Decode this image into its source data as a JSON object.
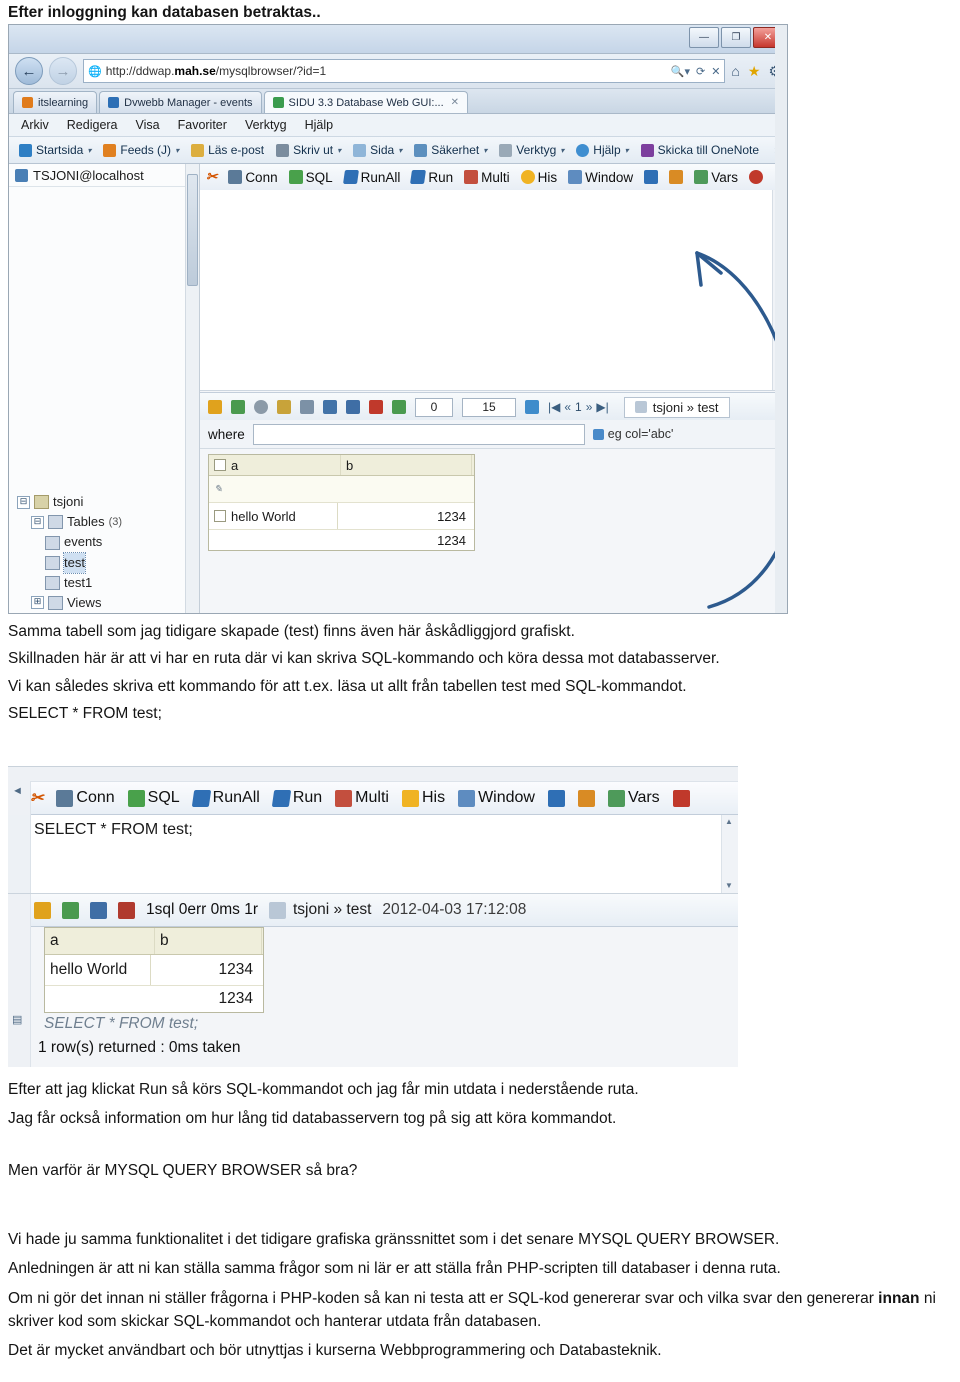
{
  "intro": "Efter inloggning kan databasen betraktas..",
  "screenshot1": {
    "browser": {
      "window_buttons": [
        "—",
        "❐",
        "✕"
      ],
      "url_prefix": "http://ddwap.",
      "url_bold": "mah.se",
      "url_suffix": "/mysqlbrowser/?id=1",
      "url_right_icons": [
        "search-caret",
        "refresh",
        "stop"
      ],
      "address_icons": [
        "home",
        "favorites-star",
        "tools-gear"
      ],
      "tabs": [
        {
          "label": "itslearning",
          "icon": "orange-square"
        },
        {
          "label": "Dvwebb Manager - events",
          "icon": "blue-square"
        },
        {
          "label": "SIDU 3.3 Database Web GUI:...",
          "icon": "green-square",
          "close": "✕",
          "active": true
        }
      ],
      "menu": [
        "Arkiv",
        "Redigera",
        "Visa",
        "Favoriter",
        "Verktyg",
        "Hjälp"
      ],
      "command_bar": [
        {
          "label": "Startsida",
          "icon": "home-icon",
          "caret": "▾"
        },
        {
          "label": "Feeds (J)",
          "icon": "feed-icon",
          "caret": "▾"
        },
        {
          "label": "Läs e-post",
          "icon": "mail-icon"
        },
        {
          "label": "Skriv ut",
          "icon": "print-icon",
          "caret": "▾"
        },
        {
          "label": "Sida",
          "icon": "page-icon",
          "caret": "▾"
        },
        {
          "label": "Säkerhet",
          "icon": "security-icon",
          "caret": "▾"
        },
        {
          "label": "Verktyg",
          "icon": "tools-icon",
          "caret": "▾"
        },
        {
          "label": "Hjälp",
          "icon": "help-icon",
          "caret": "▾"
        },
        {
          "label": "Skicka till OneNote",
          "icon": "onenote-icon"
        }
      ],
      "overflow": "»"
    },
    "left_panel": {
      "header": "TSJONI@localhost",
      "tree": [
        {
          "label": "tsjoni",
          "expander": "⊟",
          "level": 0,
          "icon": "db-icon"
        },
        {
          "label": "Tables",
          "count": "(3)",
          "expander": "⊟",
          "level": 1,
          "icon": "folder-icon"
        },
        {
          "label": "events",
          "level": 2,
          "icon": "table-icon"
        },
        {
          "label": "test",
          "level": 2,
          "icon": "table-icon",
          "selected": true
        },
        {
          "label": "test1",
          "level": 2,
          "icon": "table-icon"
        },
        {
          "label": "Views",
          "expander": "⊞",
          "level": 1,
          "icon": "folder-icon"
        }
      ]
    },
    "sidu_toolbar": [
      {
        "label": "",
        "icon": "scissors-icon"
      },
      {
        "label": "Conn",
        "icon": "conn-icon"
      },
      {
        "label": "SQL",
        "icon": "sql-icon"
      },
      {
        "label": "RunAll",
        "icon": "runall-icon"
      },
      {
        "label": "Run",
        "icon": "run-icon"
      },
      {
        "label": "Multi",
        "icon": "multi-icon"
      },
      {
        "label": "His",
        "icon": "history-icon"
      },
      {
        "label": "Window",
        "icon": "window-icon"
      },
      {
        "label": "",
        "icon": "arrow-left-icon"
      },
      {
        "label": "",
        "icon": "pin-icon"
      },
      {
        "label": "Vars",
        "icon": "vars-icon"
      },
      {
        "label": "",
        "icon": "stop-icon"
      }
    ],
    "results_bar": {
      "icons": [
        "download-icon",
        "upload-icon",
        "gear-icon",
        "key-icon",
        "eye-icon",
        "grid-icon",
        "save-icon",
        "delete-icon",
        "add-icon"
      ],
      "offset_value": "0",
      "limit_value": "15",
      "go_icon": "go-icon",
      "pager": [
        "|◀",
        "«",
        "1",
        "»",
        "▶|"
      ],
      "result_title": "tsjoni » test",
      "result_title_icon": "table-icon"
    },
    "where_row": {
      "label": "where",
      "input_value": "",
      "hint": "eg col='abc'",
      "hint_icon": "hint-icon"
    },
    "grid": {
      "columns": [
        "a",
        "b"
      ],
      "rows": [
        [
          "hello World",
          "1234"
        ],
        [
          "",
          "1234"
        ]
      ]
    }
  },
  "caption1": [
    "Samma tabell som jag tidigare skapade (test) finns även här åskådliggjord grafiskt.",
    "Skillnaden här är att vi har en ruta där vi kan skriva SQL-kommando och köra dessa mot databasserver.",
    "Vi kan således skriva ett kommando för att t.ex. läsa ut allt från tabellen test med SQL-kommandot.",
    "SELECT * FROM test;"
  ],
  "screenshot2": {
    "toolbar": [
      {
        "label": "",
        "icon": "scissors-icon"
      },
      {
        "label": "Conn",
        "icon": "conn-icon"
      },
      {
        "label": "SQL",
        "icon": "sql-icon"
      },
      {
        "label": "RunAll",
        "icon": "runall-icon"
      },
      {
        "label": "Run",
        "icon": "run-icon"
      },
      {
        "label": "Multi",
        "icon": "multi-icon"
      },
      {
        "label": "His",
        "icon": "history-icon"
      },
      {
        "label": "Window",
        "icon": "window-icon"
      },
      {
        "label": "",
        "icon": "arrow-left-icon"
      },
      {
        "label": "",
        "icon": "pin-icon"
      },
      {
        "label": "Vars",
        "icon": "vars-icon"
      },
      {
        "label": "",
        "icon": "stop-icon"
      }
    ],
    "editor_sql": "SELECT * FROM test;",
    "results_bar": {
      "icons": [
        "download-icon",
        "upload-icon",
        "chart-bar-icon",
        "chart-col-icon"
      ],
      "stats": "1sql  0err  0ms  1r",
      "result_title": "tsjoni » test",
      "timestamp": "2012-04-03 17:12:08"
    },
    "grid": {
      "columns": [
        "a",
        "b"
      ],
      "rows": [
        [
          "hello World",
          "1234"
        ],
        [
          "",
          "1234"
        ]
      ]
    },
    "echo_sql": "SELECT * FROM test;",
    "returned": "1 row(s) returned : 0ms taken"
  },
  "after2": [
    "Efter att jag klickat Run så körs SQL-kommandot och jag får min utdata i nederstående ruta.",
    "Jag får också information om hur lång tid databasservern tog på sig att köra kommandot.",
    "Men varför är MYSQL QUERY BROWSER så bra?"
  ],
  "final": {
    "p1": "Vi hade ju samma funktionalitet i det tidigare grafiska gränssnittet som i det senare MYSQL QUERY BROWSER.",
    "p2": "Anledningen är att ni kan ställa samma frågor som ni lär er att ställa från PHP-scripten till databaser i denna ruta.",
    "p3_a": "Om ni gör det innan ni ställer frågorna i PHP-koden så kan ni testa att er SQL-kod genererar svar och vilka svar den genererar ",
    "p3_b": "innan",
    "p3_c": " ni skriver kod som skickar SQL-kommandot och hanterar utdata från databasen.",
    "p4": "Det är mycket användbart och bör utnyttjas i kurserna Webbprogrammering och Databasteknik."
  }
}
